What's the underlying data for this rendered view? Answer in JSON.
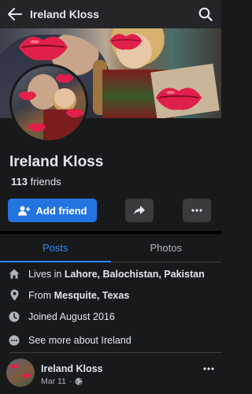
{
  "header": {
    "title": "Ireland Kloss",
    "back_icon": "arrow-left-icon",
    "search_icon": "search-icon"
  },
  "profile": {
    "name": "Ireland Kloss",
    "friends_count": "113",
    "friends_label": "friends"
  },
  "actions": {
    "add_friend_label": "Add friend",
    "add_friend_icon": "add-user-icon",
    "share_icon": "share-icon",
    "more_icon": "more-horizontal-icon",
    "primary_color": "#2374e1"
  },
  "tabs": [
    {
      "label": "Posts",
      "active": true
    },
    {
      "label": "Photos",
      "active": false
    }
  ],
  "intro": {
    "lives_prefix": "Lives in",
    "lives_value": "Lahore, Balochistan, Pakistan",
    "from_prefix": "From",
    "from_value": "Mesquite, Texas",
    "joined": "Joined August 2016",
    "see_more": "See more about Ireland"
  },
  "post": {
    "author": "Ireland Kloss",
    "date": "Mar 11",
    "separator": "·",
    "privacy_icon": "globe-icon"
  }
}
